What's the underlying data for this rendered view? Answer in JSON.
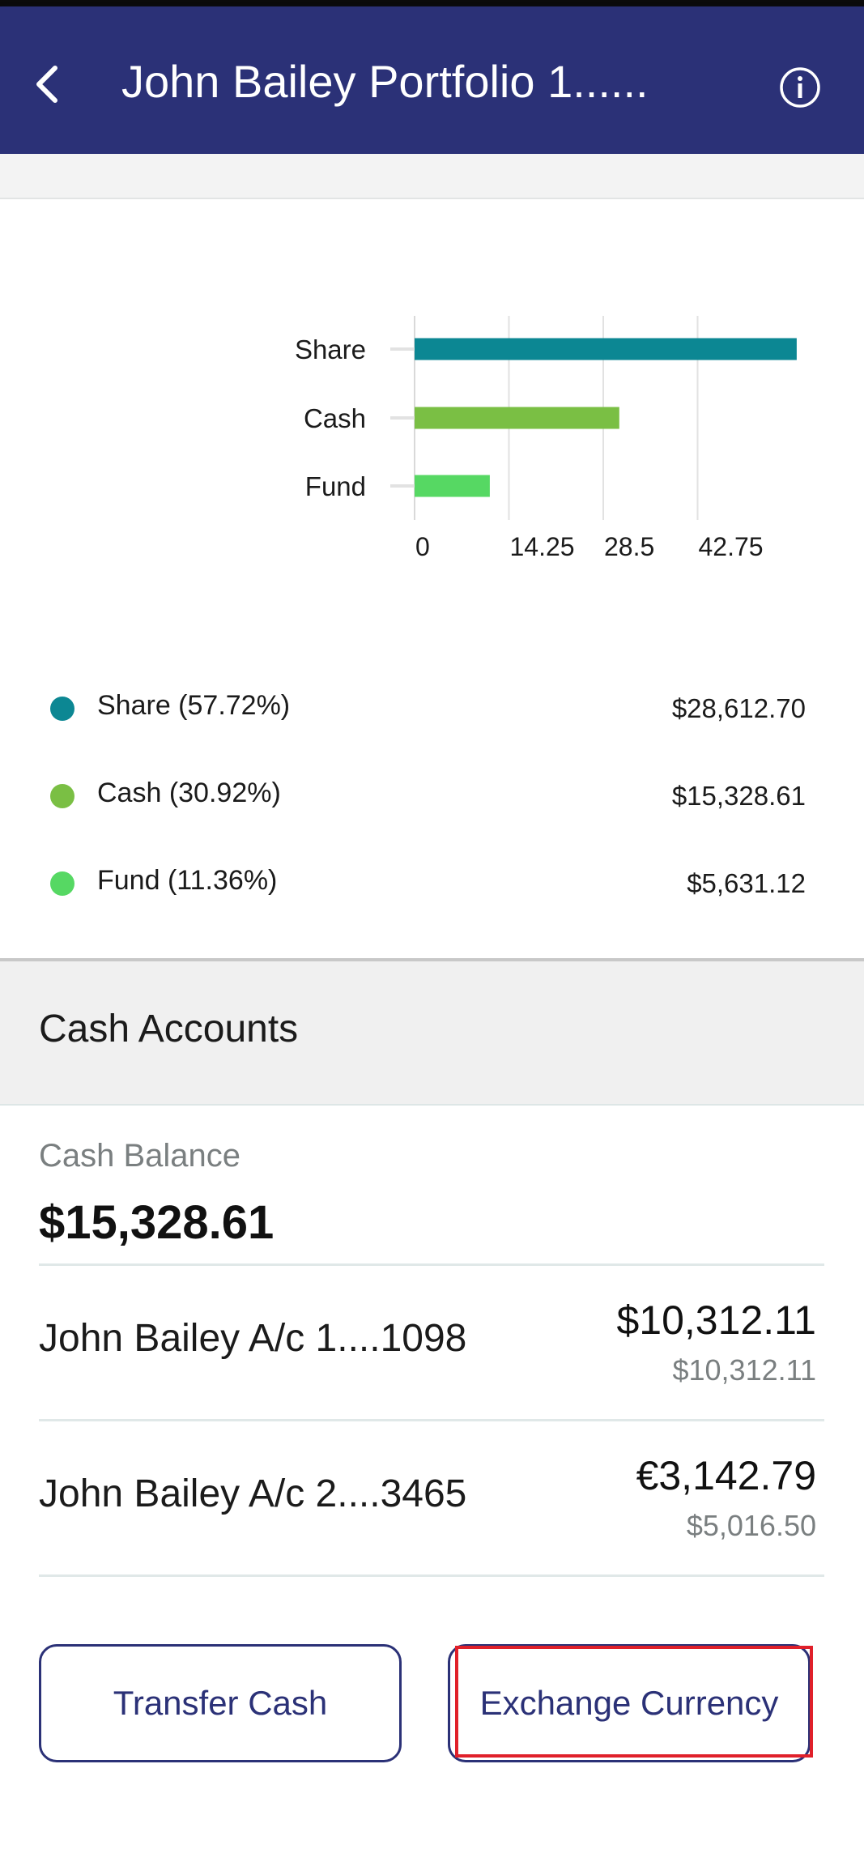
{
  "app_bar": {
    "title": "John Bailey Portfolio 1......",
    "back_icon": "chevron-left-icon",
    "info_icon": "info-circle-icon"
  },
  "chart_data": {
    "type": "bar",
    "orientation": "horizontal",
    "categories": [
      "Share",
      "Cash",
      "Fund"
    ],
    "values": [
      57.72,
      30.92,
      11.36
    ],
    "xlim": [
      0,
      57
    ],
    "xticks": [
      "0",
      "14.25",
      "28.5",
      "42.75"
    ],
    "grid": true,
    "colors": [
      "#0c8793",
      "#7abf44",
      "#56d863"
    ]
  },
  "legend": [
    {
      "label": "Share (57.72%)",
      "value": "$28,612.70",
      "color": "#0c8793"
    },
    {
      "label": "Cash (30.92%)",
      "value": "$15,328.61",
      "color": "#7abf44"
    },
    {
      "label": "Fund (11.36%)",
      "value": "$5,631.12",
      "color": "#56d863"
    }
  ],
  "cash_accounts": {
    "title": "Cash Accounts",
    "balance_label": "Cash Balance",
    "balance_value": "$15,328.61",
    "accounts": [
      {
        "name": "John Bailey A/c 1....1098",
        "amount": "$10,312.11",
        "sub_amount": "$10,312.11"
      },
      {
        "name": "John Bailey A/c 2....3465",
        "amount": "€3,142.79",
        "sub_amount": "$5,016.50"
      }
    ]
  },
  "actions": {
    "transfer_label": "Transfer Cash",
    "exchange_label": "Exchange Currency"
  },
  "colors": {
    "app_bar": "#2b3177",
    "button_text": "#2b3177",
    "highlight": "#e0202a"
  }
}
